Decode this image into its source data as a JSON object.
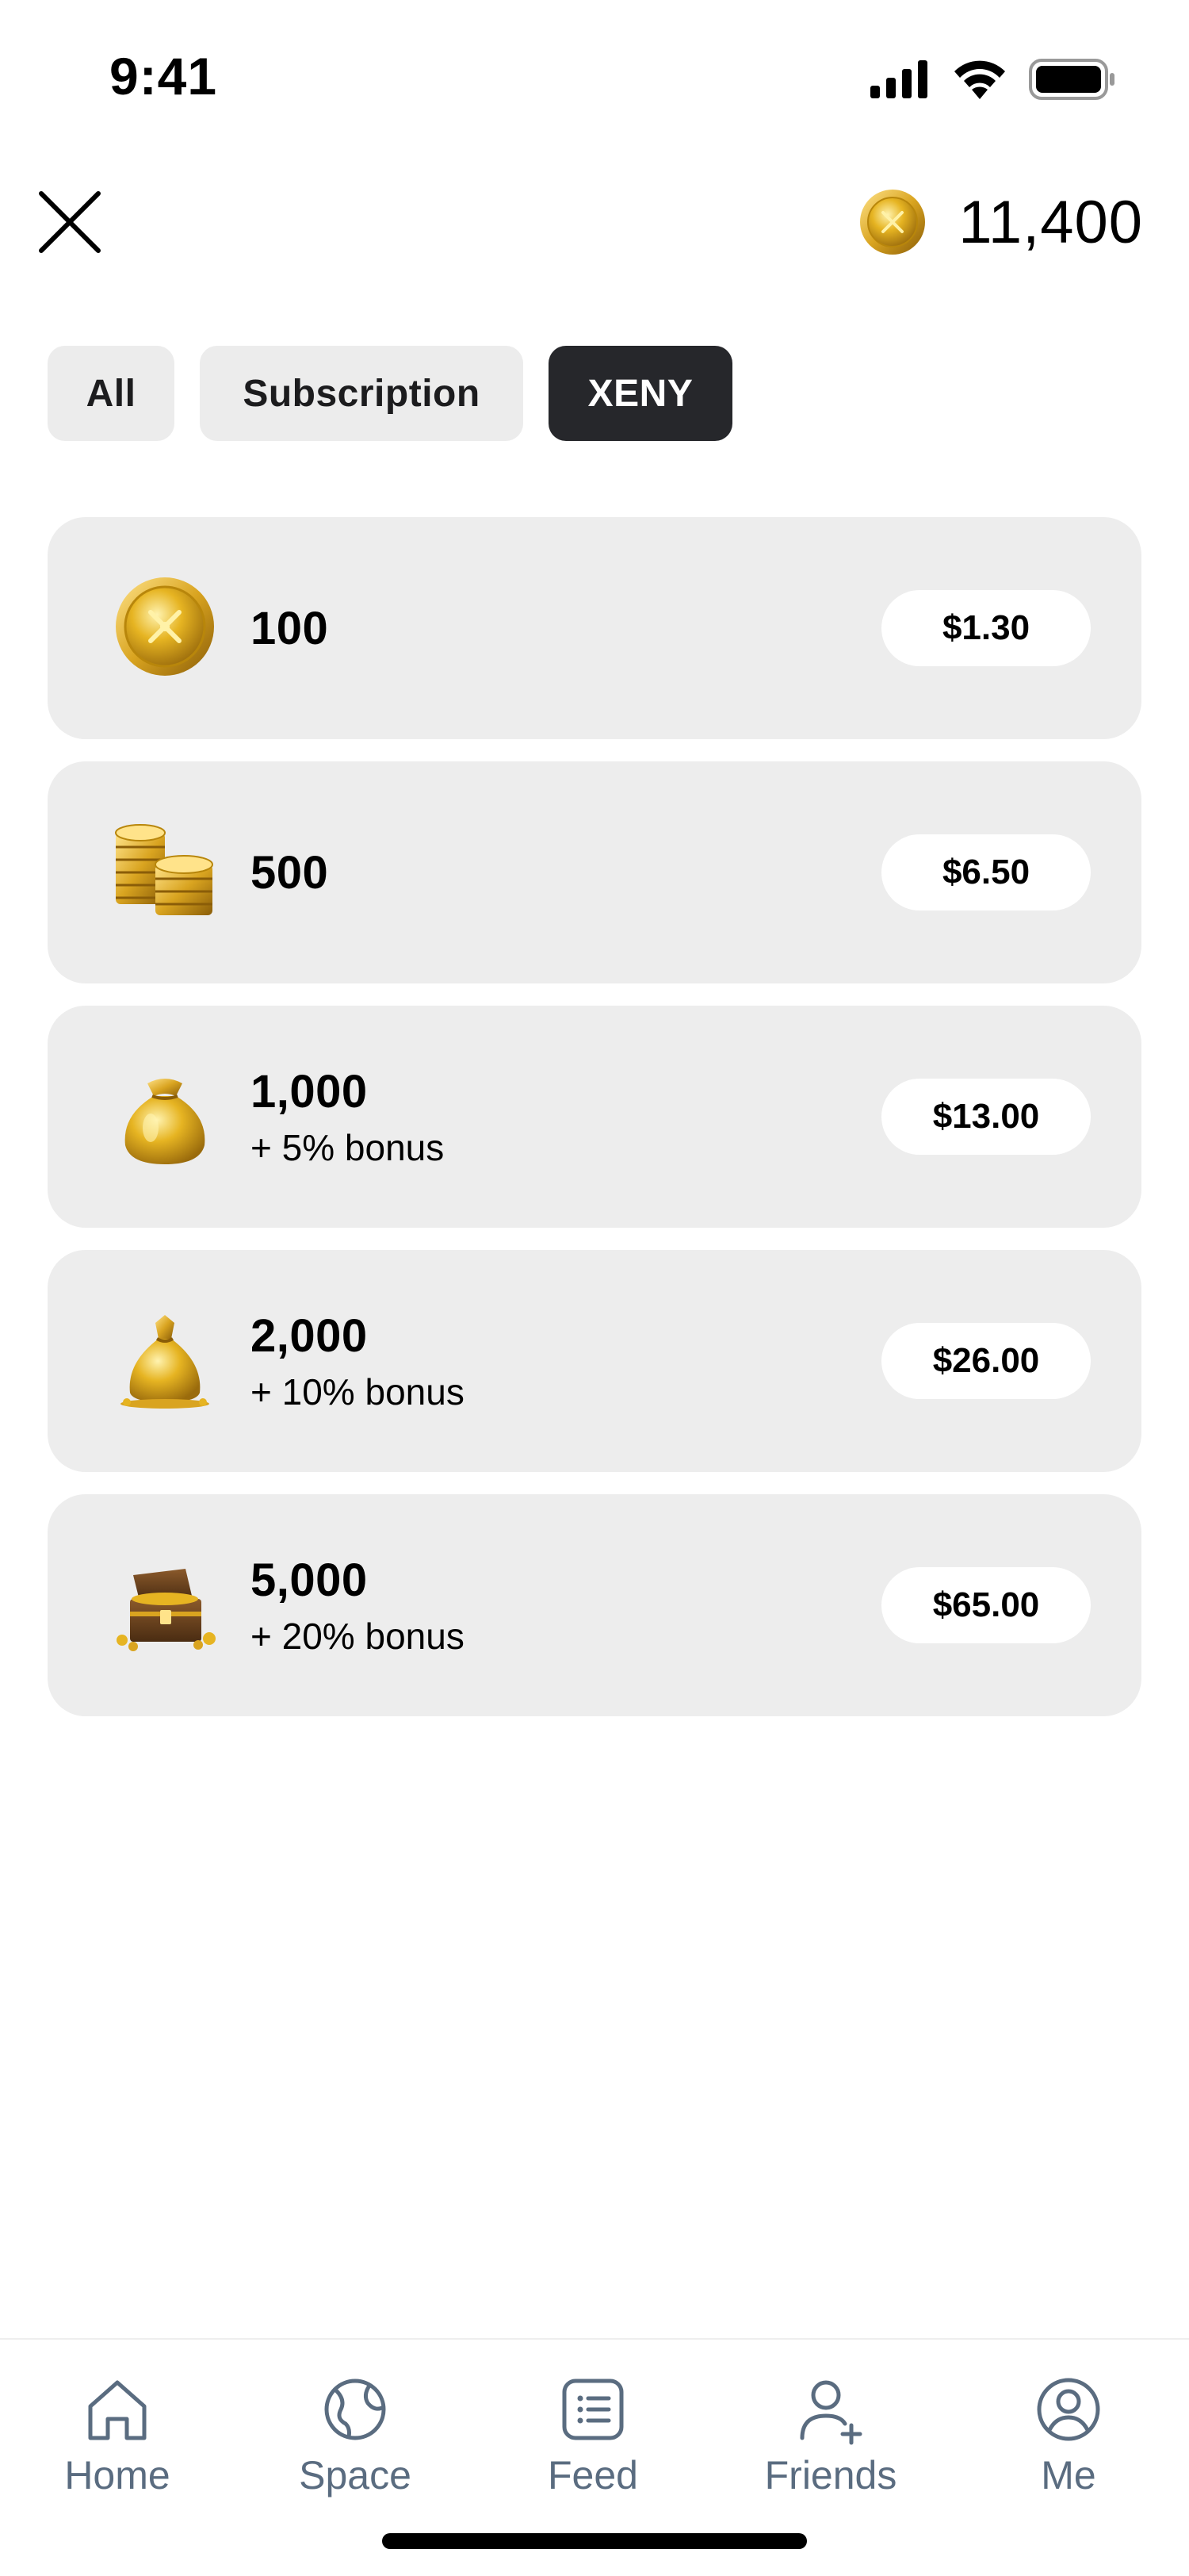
{
  "status_bar": {
    "time": "9:41",
    "icons": [
      "cellular-signal-icon",
      "wifi-icon",
      "battery-icon"
    ]
  },
  "header": {
    "close_icon": "close-icon",
    "balance": "11,400",
    "balance_icon": "gold-coin-icon"
  },
  "tabs": [
    {
      "label": "All",
      "selected": false
    },
    {
      "label": "Subscription",
      "selected": false
    },
    {
      "label": "XENY",
      "selected": true
    }
  ],
  "packages": [
    {
      "amount": "100",
      "bonus": "",
      "price": "$1.30",
      "icon": "single-coin-icon"
    },
    {
      "amount": "500",
      "bonus": "",
      "price": "$6.50",
      "icon": "coin-stacks-icon"
    },
    {
      "amount": "1,000",
      "bonus": "+ 5% bonus",
      "price": "$13.00",
      "icon": "gold-pouch-icon"
    },
    {
      "amount": "2,000",
      "bonus": "+ 10% bonus",
      "price": "$26.00",
      "icon": "gold-sack-icon"
    },
    {
      "amount": "5,000",
      "bonus": "+ 20% bonus",
      "price": "$65.00",
      "icon": "treasure-chest-icon"
    }
  ],
  "bottom_nav": [
    {
      "label": "Home",
      "icon": "home-icon"
    },
    {
      "label": "Space",
      "icon": "globe-icon"
    },
    {
      "label": "Feed",
      "icon": "feed-list-icon"
    },
    {
      "label": "Friends",
      "icon": "add-friend-icon"
    },
    {
      "label": "Me",
      "icon": "profile-icon"
    }
  ],
  "colors": {
    "accent_dark": "#26272b",
    "card_bg": "#ededed",
    "nav_gray": "#5a6c80",
    "gold": "#d4a017"
  }
}
